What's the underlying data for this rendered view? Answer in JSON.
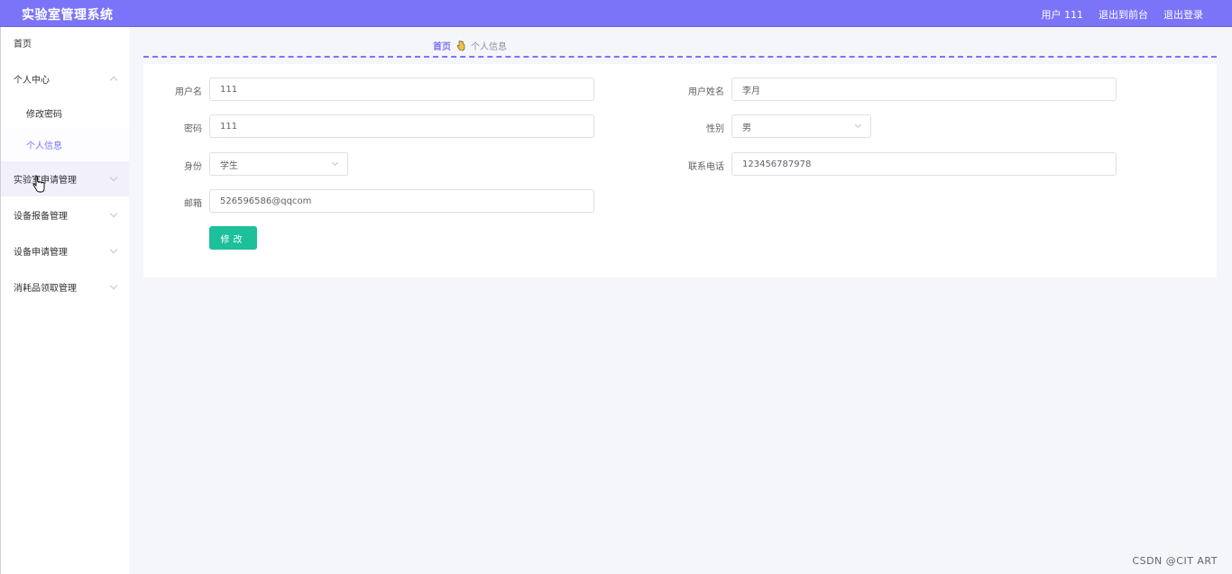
{
  "app": {
    "title": "实验室管理系统"
  },
  "header": {
    "user_label": "用户 111",
    "back_frontend": "退出到前台",
    "logout": "退出登录"
  },
  "sidebar": {
    "home": "首页",
    "personal_center": "个人中心",
    "change_password": "修改密码",
    "personal_info": "个人信息",
    "lab_application": "实验室申请管理",
    "equipment_repair": "设备报备管理",
    "equipment_application": "设备申请管理",
    "consumables": "消耗品领取管理"
  },
  "breadcrumb": {
    "home": "首页",
    "current": "个人信息"
  },
  "form": {
    "username_label": "用户名",
    "username_value": "111",
    "realname_label": "用户姓名",
    "realname_value": "李月",
    "password_label": "密码",
    "password_value": "111",
    "gender_label": "性别",
    "gender_value": "男",
    "role_label": "身份",
    "role_value": "学生",
    "phone_label": "联系电话",
    "phone_value": "123456787978",
    "email_label": "邮箱",
    "email_value": "526596586@qqcom",
    "submit_label": "修改"
  },
  "watermark": "CSDN @CIT ART",
  "colors": {
    "primary": "#7b74f9",
    "button": "#1cc09b"
  }
}
